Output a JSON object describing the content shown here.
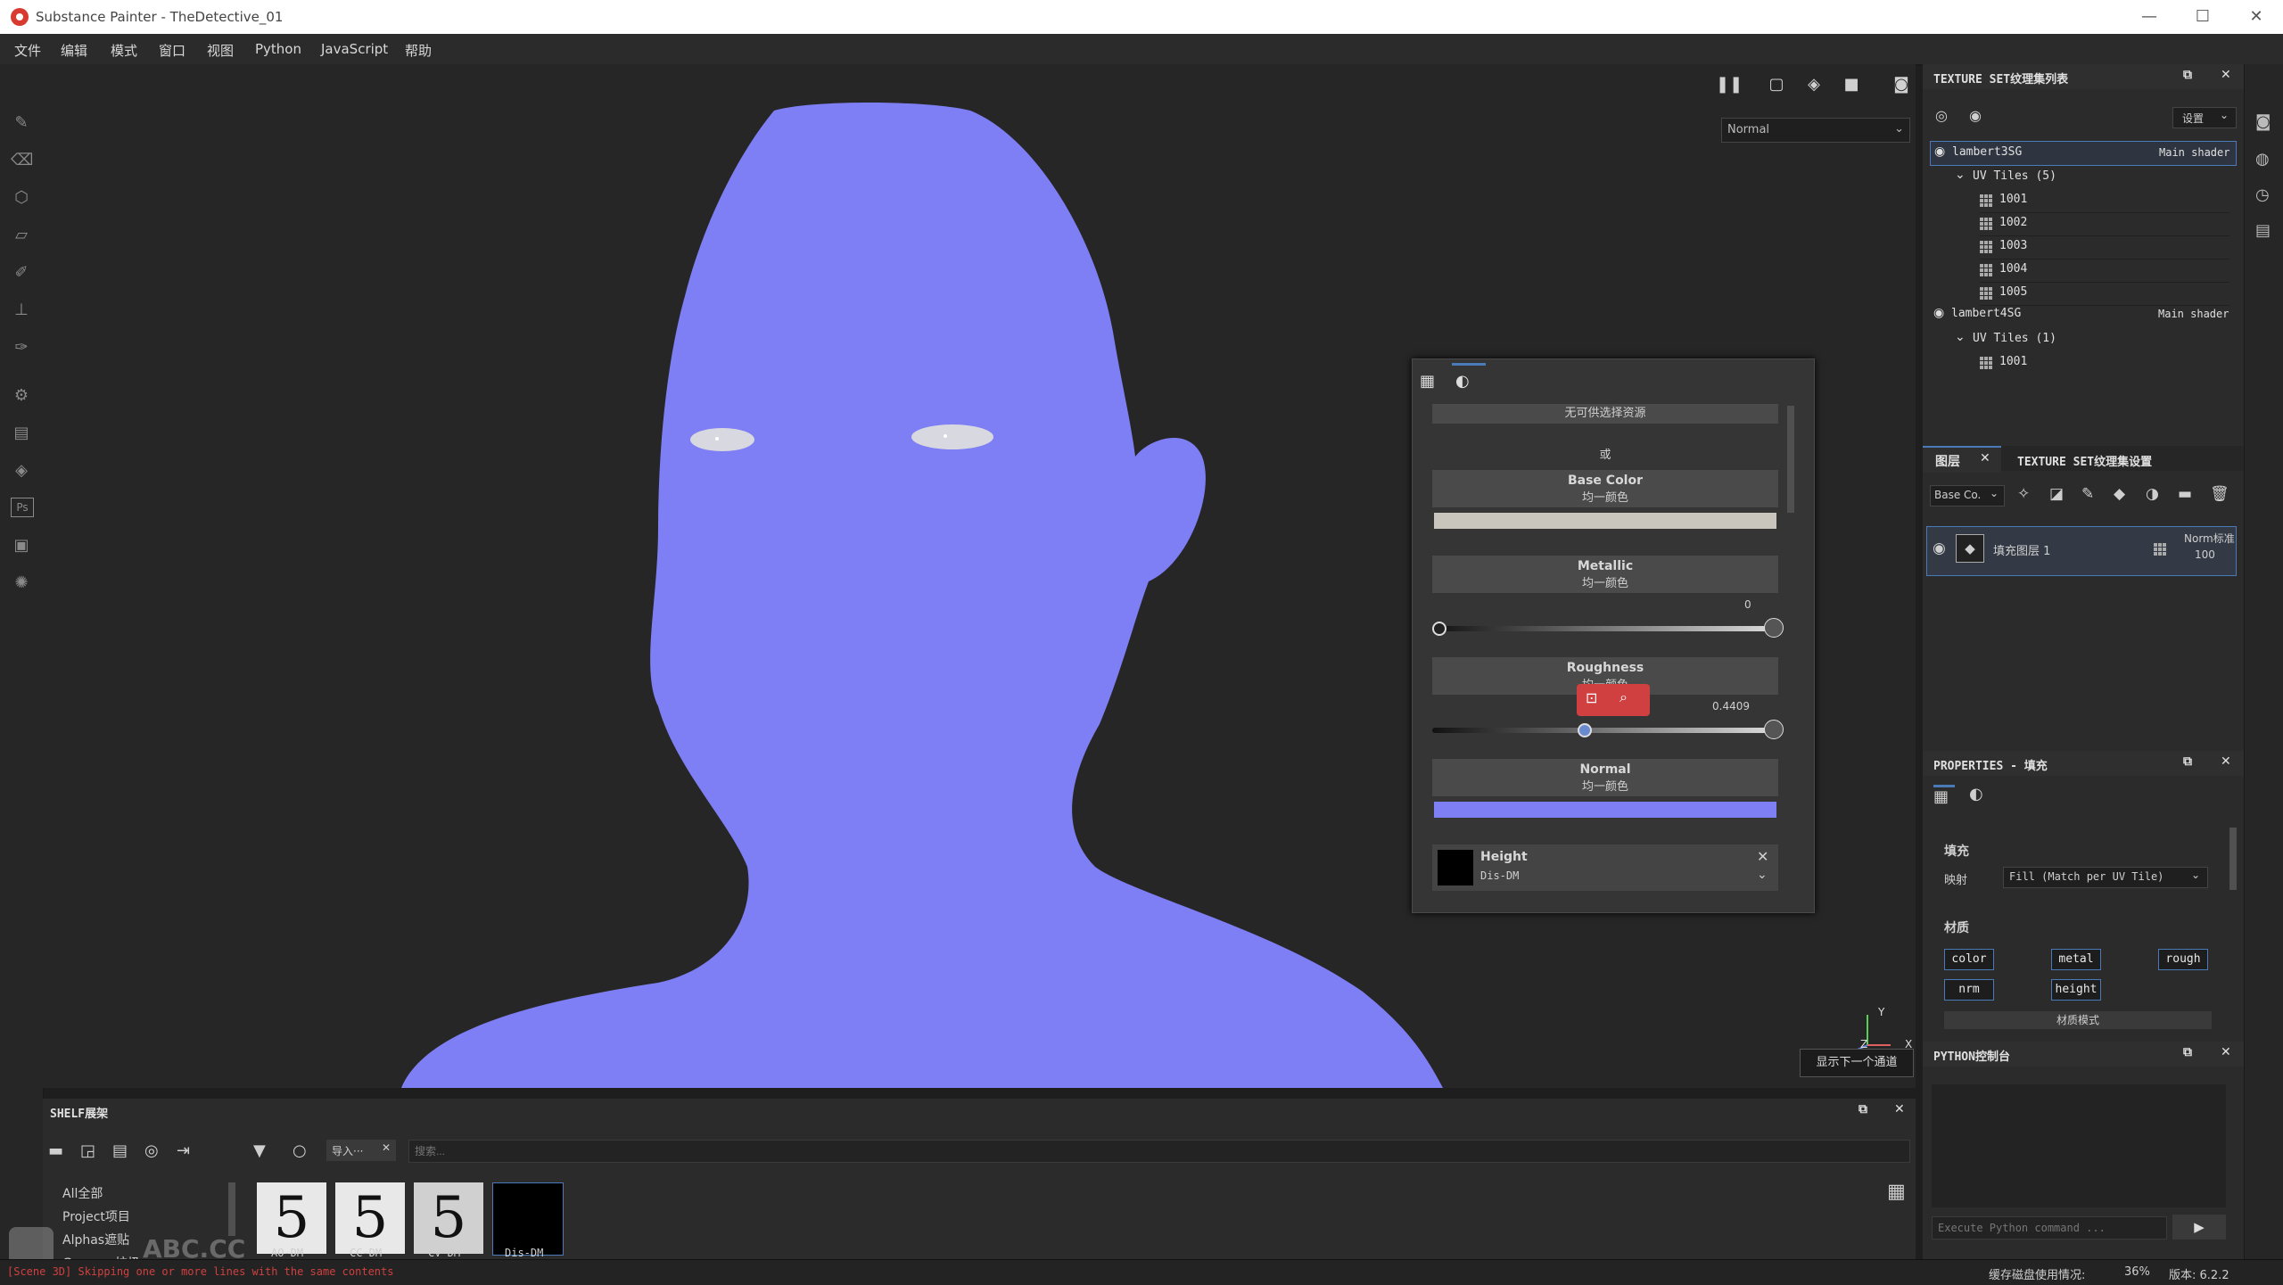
{
  "window": {
    "title": "Substance Painter - TheDetective_01",
    "controls": [
      "—",
      "☐",
      "✕"
    ]
  },
  "menu": [
    "文件",
    "编辑",
    "模式",
    "窗口",
    "视图",
    "Python",
    "JavaScript",
    "帮助"
  ],
  "viewport": {
    "mode_dropdown": "Normal",
    "axis_labels": {
      "y": "Y",
      "z": "Z",
      "x": "X"
    },
    "tooltip": "显示下一个通道"
  },
  "material_panel": {
    "no_resource": "无可供选择资源",
    "or": "或",
    "base_color": {
      "label": "Base Color",
      "sub": "均一颜色",
      "swatch": "#c9c4bc"
    },
    "metallic": {
      "label": "Metallic",
      "sub": "均一颜色",
      "value": "0",
      "fraction": 0
    },
    "roughness": {
      "label": "Roughness",
      "sub": "均一颜色",
      "value": "0.4409",
      "fraction": 0.4409
    },
    "normal": {
      "label": "Normal",
      "sub": "均一颜色",
      "swatch": "#7f7ff5"
    },
    "height": {
      "label": "Height",
      "map": "Dis-DM"
    }
  },
  "texture_set_list": {
    "title": "TEXTURE SET纹理集列表",
    "settings_label": "设置",
    "sets": [
      {
        "name": "lambert3SG",
        "shader": "Main shader",
        "uv_label": "UV Tiles (5)",
        "tiles": [
          "1001",
          "1002",
          "1003",
          "1004",
          "1005"
        ]
      },
      {
        "name": "lambert4SG",
        "shader": "Main shader",
        "uv_label": "UV Tiles (1)",
        "tiles": [
          "1001"
        ]
      }
    ]
  },
  "layers": {
    "tab_layers": "图层",
    "tab_settings": "TEXTURE SET纹理集设置",
    "channel_dropdown": "Base Co.",
    "layer": {
      "name": "填充图层 1",
      "blend": "Norm标准",
      "opacity": "100"
    }
  },
  "properties": {
    "title": "PROPERTIES - 填充",
    "fill_heading": "填充",
    "mapping_label": "映射",
    "mapping_value": "Fill (Match per UV Tile)",
    "material_heading": "材质",
    "chips": [
      "color",
      "metal",
      "rough",
      "nrm",
      "height"
    ],
    "material_mode": "材质模式"
  },
  "python_console": {
    "title": "PYTHON控制台",
    "placeholder": "Execute Python command ..."
  },
  "shelf": {
    "title": "SHELF展架",
    "filter_tag": "导入···",
    "search_placeholder": "搜索...",
    "categories": [
      "All全部",
      "Project项目",
      "Alphas遮贴",
      "Grunges垃圾"
    ],
    "thumbs": [
      {
        "label": "AO-DM",
        "glyph": "5"
      },
      {
        "label": "CC-DM",
        "glyph": "5"
      },
      {
        "label": "CV-DM",
        "glyph": "5"
      },
      {
        "label": "Dis-DM",
        "glyph": ""
      }
    ]
  },
  "status": {
    "log": "[Scene 3D] Skipping one or more lines with the same contents",
    "cache": "缓存磁盘使用情况:",
    "cache_pct": "36%",
    "version": "版本: 6.2.2"
  },
  "watermark": "ABC.CC",
  "colors": {
    "accent": "#4a7ab8",
    "head": "#7f7ff5",
    "error": "#d04040"
  }
}
